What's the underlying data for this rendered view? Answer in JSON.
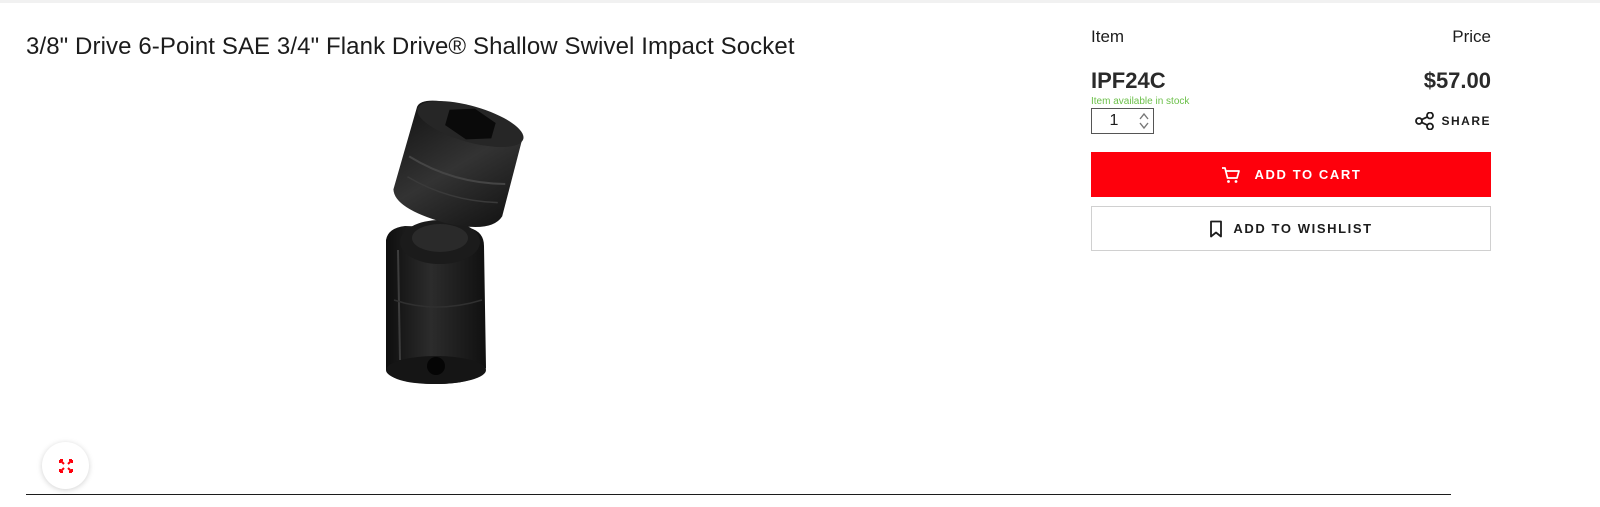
{
  "product": {
    "title": "3/8\" Drive 6-Point SAE 3/4\" Flank Drive® Shallow Swivel Impact Socket",
    "image_icon": "swivel-impact-socket-image"
  },
  "purchase": {
    "item_header": "Item",
    "price_header": "Price",
    "sku": "IPF24C",
    "price": "$57.00",
    "stock_status": "Item available in stock",
    "quantity": "1",
    "share_label": "SHARE",
    "add_to_cart_label": "ADD TO CART",
    "add_to_wishlist_label": "ADD TO WISHLIST"
  },
  "colors": {
    "brand_red": "#fe000c",
    "stock_green": "#6cc04a",
    "text_dark": "#1c1c1c"
  },
  "icons": {
    "expand": "expand-arrows-icon",
    "share": "share-icon",
    "cart": "cart-icon",
    "wishlist": "bookmark-icon",
    "qty_stepper": "stepper-arrows-icon"
  }
}
